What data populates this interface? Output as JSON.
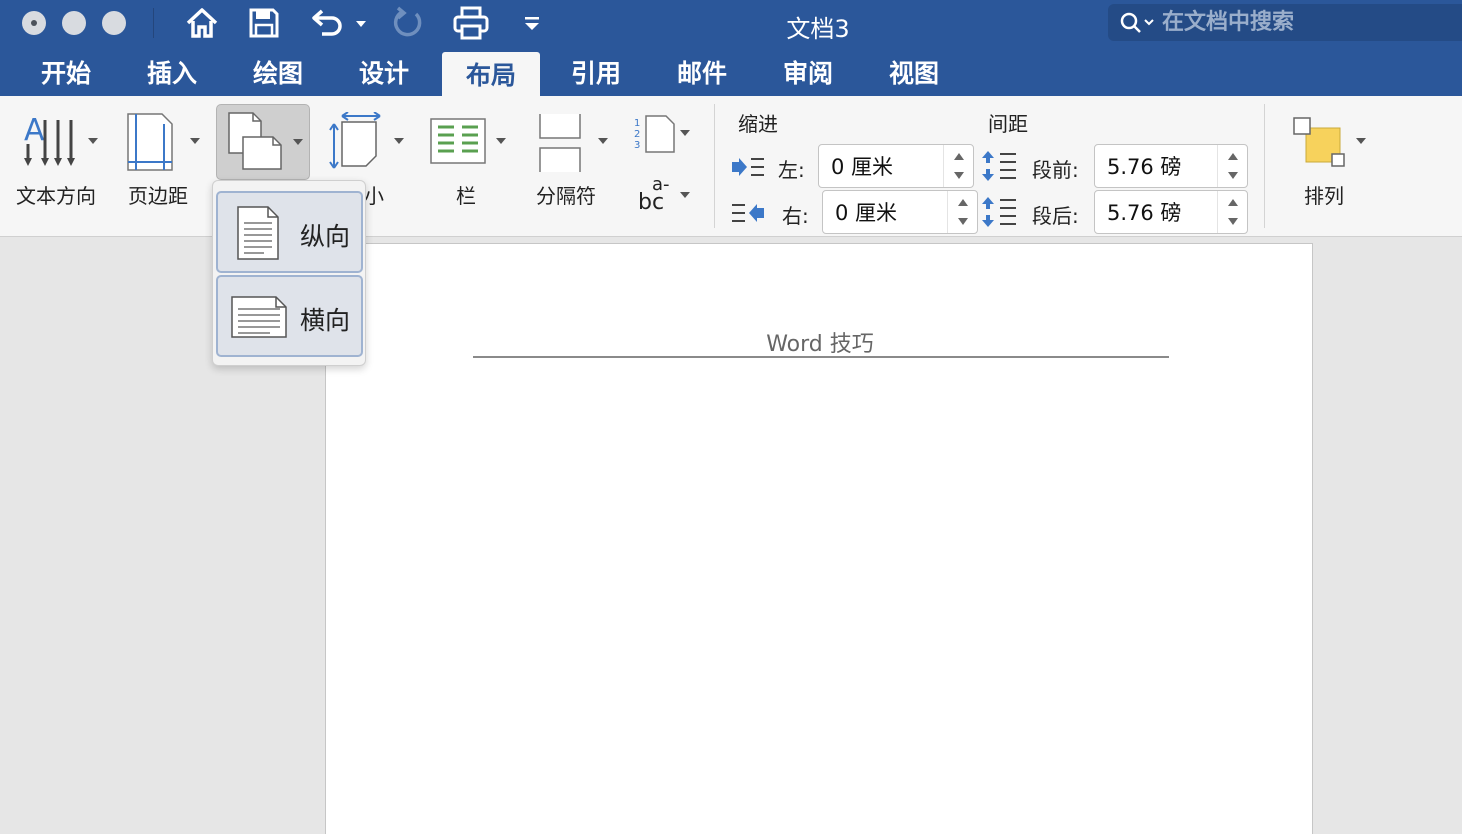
{
  "window": {
    "title": "文档3",
    "search_placeholder": "在文档中搜索"
  },
  "tabs": [
    {
      "label": "开始"
    },
    {
      "label": "插入"
    },
    {
      "label": "绘图"
    },
    {
      "label": "设计"
    },
    {
      "label": "布局",
      "active": true
    },
    {
      "label": "引用"
    },
    {
      "label": "邮件"
    },
    {
      "label": "审阅"
    },
    {
      "label": "视图"
    }
  ],
  "ribbon": {
    "text_direction": "文本方向",
    "margins": "页边距",
    "size_partial": "小",
    "columns": "栏",
    "breaks": "分隔符",
    "hyphenation_glyph_top": "a-",
    "hyphenation_glyph_bottom": "bc",
    "indent_header": "缩进",
    "spacing_header": "间距",
    "indent_left_label": "左:",
    "indent_left_value": "0 厘米",
    "indent_right_label": "右:",
    "indent_right_value": "0 厘米",
    "spacing_before_label": "段前:",
    "spacing_before_value": "5.76 磅",
    "spacing_after_label": "段后:",
    "spacing_after_value": "5.76 磅",
    "arrange": "排列"
  },
  "orientation_menu": {
    "portrait": "纵向",
    "landscape": "横向"
  },
  "document": {
    "header_text": "Word 技巧"
  },
  "colors": {
    "accent": "#2b579a",
    "ribbon_bg": "#f6f6f6",
    "canvas_bg": "#e6e6e6"
  },
  "icons": [
    "home-icon",
    "save-icon",
    "undo-icon",
    "redo-icon",
    "print-icon",
    "customize-icon",
    "search-icon",
    "text-direction-icon",
    "margins-icon",
    "orientation-icon",
    "size-icon",
    "columns-icon",
    "breaks-icon",
    "line-numbers-icon",
    "hyphenation-icon",
    "indent-left-icon",
    "indent-right-icon",
    "spacing-before-icon",
    "spacing-after-icon",
    "arrange-icon",
    "portrait-icon",
    "landscape-icon"
  ]
}
